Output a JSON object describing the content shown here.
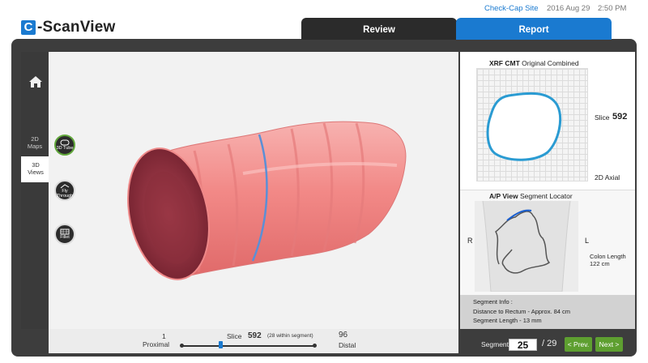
{
  "header": {
    "logo_letter": "C",
    "logo_text": "-ScanView",
    "link": "Check-Cap Site",
    "date": "2016 Aug 29",
    "time": "2:50 PM"
  },
  "tabs": [
    {
      "label": "Review",
      "active": true
    },
    {
      "label": "Report",
      "active": false
    }
  ],
  "leftnav": {
    "home": "home-icon",
    "items": [
      {
        "label_line1": "2D",
        "label_line2": "Maps"
      },
      {
        "label_line1": "3D",
        "label_line2": "Views"
      }
    ]
  },
  "tools": [
    {
      "label": "3D Tube",
      "icon": "tube-icon",
      "active": true
    },
    {
      "label_line1": "Fly",
      "label_line2": "Through",
      "icon": "fly-through-icon"
    },
    {
      "label": "Fillet",
      "icon": "fillet-icon"
    }
  ],
  "slice_bar": {
    "start_value": "1",
    "start_label": "Proximal",
    "slice_label": "Slice",
    "slice_value": "592",
    "slice_note": "(28 within segment)",
    "end_value": "96",
    "end_label": "Distal",
    "position": 0.29
  },
  "axial_panel": {
    "title_bold": "XRF CMT",
    "title_rest": "Original Combined",
    "slice_label": "Slice",
    "slice_value": "592",
    "view_label": "2D Axial"
  },
  "locator_panel": {
    "title_bold": "A/P View",
    "title_rest": "Segment Locator",
    "left_label": "R",
    "right_label": "L",
    "length_label": "Colon Length",
    "length_value": "122 cm"
  },
  "segment_info": {
    "title": "Segment Info :",
    "line1": "Distance to Rectum - Approx. 84 cm",
    "line2": "Segment Length - 13 mm"
  },
  "segment_nav": {
    "label": "Segment",
    "current": "25",
    "total": "/ 29",
    "prev_label": "< Prev.",
    "next_label": "Next >"
  },
  "colors": {
    "accent_blue": "#1a7ad0",
    "button_green": "#5e9f30",
    "frame_dark": "#3d3d3d"
  }
}
